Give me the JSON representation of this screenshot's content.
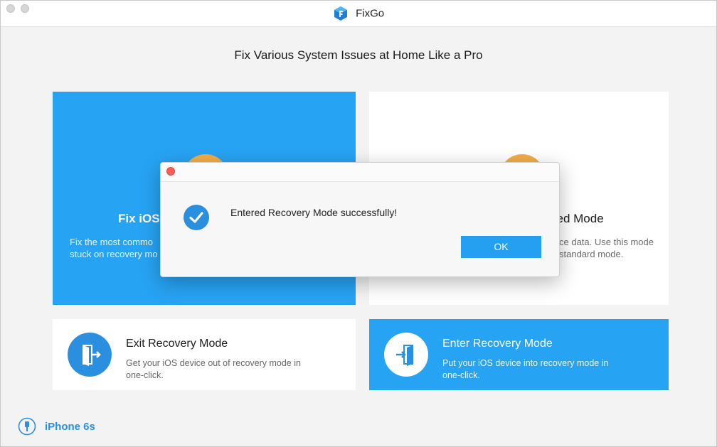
{
  "window": {
    "title": "FixGo"
  },
  "headline": "Fix Various System Issues at Home Like a Pro",
  "cards": {
    "standard": {
      "title": "Fix iOS S",
      "desc_line1": "Fix the most commo",
      "desc_line2": "stuck on recovery mo"
    },
    "advanced": {
      "title": "ced Mode",
      "desc_line1": "ce data. Use this mode",
      "desc_line2": "standard mode."
    },
    "exit": {
      "title": "Exit Recovery Mode",
      "desc_line1": "Get your iOS device out of recovery mode in",
      "desc_line2": "one-click."
    },
    "enter": {
      "title": "Enter Recovery Mode",
      "desc_line1": "Put your iOS device into recovery mode in",
      "desc_line2": "one-click."
    }
  },
  "device": {
    "name": "iPhone 6s",
    "icon": "usb-cable-icon"
  },
  "dialog": {
    "message": "Entered Recovery Mode successfully!",
    "ok_label": "OK",
    "icon": "checkmark-circle-icon"
  },
  "colors": {
    "accent_blue": "#27a3f3",
    "button_blue": "#259ff0",
    "orange": "#f2ad47",
    "close_red": "#ff5f57"
  }
}
